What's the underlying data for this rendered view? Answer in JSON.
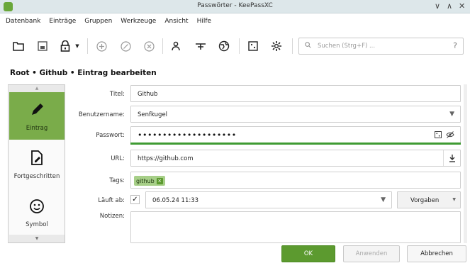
{
  "window": {
    "title": "Passwörter - KeePassXC",
    "controls": {
      "minimize": "∨",
      "maximize": "∧",
      "close": "✕"
    }
  },
  "menu": [
    "Datenbank",
    "Einträge",
    "Gruppen",
    "Werkzeuge",
    "Ansicht",
    "Hilfe"
  ],
  "toolbar": {
    "icons": [
      "folder-open-icon",
      "save-icon",
      "lock-icon",
      "add-entry-icon",
      "edit-entry-icon",
      "delete-entry-icon",
      "copy-username-icon",
      "copy-password-icon",
      "copy-url-icon",
      "password-generator-icon",
      "settings-icon"
    ],
    "search_placeholder": "Suchen (Strg+F) ...",
    "search_help": "?"
  },
  "breadcrumb": "Root • Github • Eintrag bearbeiten",
  "sidebar": {
    "items": [
      {
        "label": "Eintrag",
        "icon": "pencil-icon",
        "active": true
      },
      {
        "label": "Fortgeschritten",
        "icon": "document-edit-icon",
        "active": false
      },
      {
        "label": "Symbol",
        "icon": "smiley-icon",
        "active": false
      }
    ]
  },
  "form": {
    "title_label": "Titel:",
    "title_value": "Github",
    "username_label": "Benutzername:",
    "username_value": "Senfkugel",
    "password_label": "Passwort:",
    "password_value": "••••••••••••••••••••",
    "url_label": "URL:",
    "url_value": "https://github.com",
    "tags_label": "Tags:",
    "tags": [
      "github"
    ],
    "expires_label": "Läuft ab:",
    "expires_checked": true,
    "expires_value": "06.05.24 11:33",
    "presets_label": "Vorgaben",
    "notes_label": "Notizen:",
    "notes_value": ""
  },
  "buttons": {
    "ok": "OK",
    "apply": "Anwenden",
    "cancel": "Abbrechen"
  },
  "colors": {
    "accent": "#7aac4a",
    "ok_button": "#5c9a2f",
    "password_strength": "#3f9b33"
  }
}
